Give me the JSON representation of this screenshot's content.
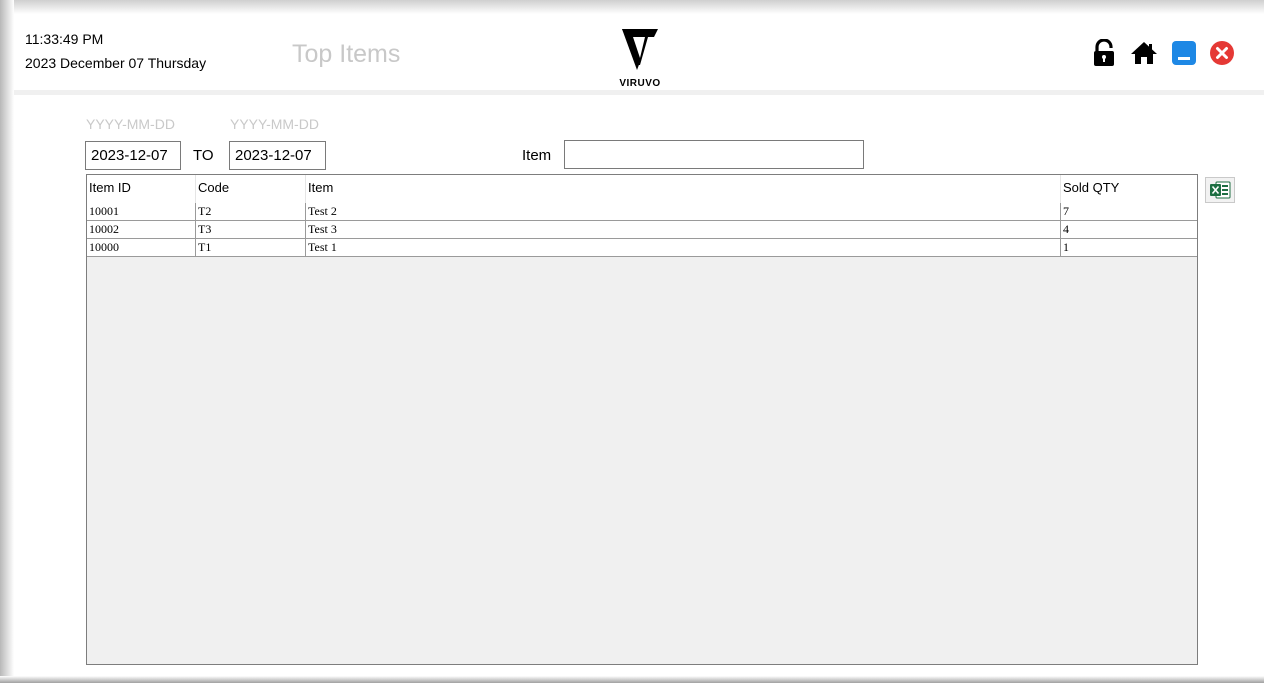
{
  "header": {
    "time": "11:33:49 PM",
    "date": "2023  December  07 Thursday",
    "title": "Top Items",
    "logo_text": "VIRUVO"
  },
  "filters": {
    "from_hint": "YYYY-MM-DD",
    "to_hint": "YYYY-MM-DD",
    "from_value": "2023-12-07",
    "to_label": "TO",
    "to_value": "2023-12-07",
    "item_label": "Item",
    "item_value": ""
  },
  "table": {
    "columns": [
      "Item ID",
      "Code",
      "Item",
      "Sold QTY"
    ],
    "rows": [
      [
        "10001",
        "T2",
        "Test 2",
        "7"
      ],
      [
        "10002",
        "T3",
        "Test 3",
        "4"
      ],
      [
        "10000",
        "T1",
        "Test 1",
        "1"
      ]
    ]
  },
  "icons": {
    "lock": "lock-icon",
    "home": "home-icon",
    "minimize": "minimize-icon",
    "close": "close-icon",
    "excel": "excel-icon"
  },
  "colors": {
    "minimize": "#1e88e5",
    "close": "#e53935",
    "excel": "#1d6f42",
    "title": "#c8c8c8",
    "hint": "#c9c9c9"
  }
}
